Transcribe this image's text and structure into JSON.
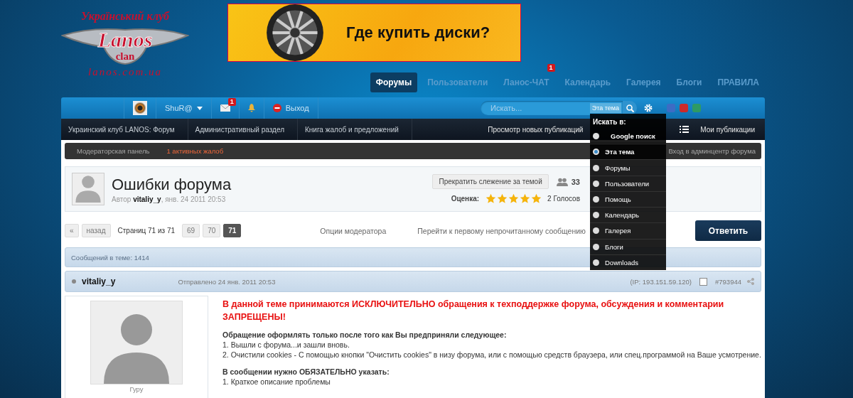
{
  "logo": {
    "tagline": "Український клуб",
    "name": "Lanos",
    "sub": "clan",
    "url": "lanos.com.ua"
  },
  "banner": {
    "text": "Где купить диски?"
  },
  "nav": [
    {
      "label": "Форумы",
      "selected": true
    },
    {
      "label": "Пользователи",
      "selected": false
    },
    {
      "label": "Ланос-ЧАТ",
      "selected": false,
      "badge": "1"
    },
    {
      "label": "Календарь",
      "selected": false
    },
    {
      "label": "Галерея",
      "selected": false
    },
    {
      "label": "Блоги",
      "selected": false
    },
    {
      "label": "ПРАВИЛА",
      "selected": false
    }
  ],
  "user_bar": {
    "username": "ShuR@",
    "messages_badge": "1",
    "logout": "Выход"
  },
  "search": {
    "placeholder": "Искать...",
    "scope": "Эта тема"
  },
  "search_menu": {
    "title": "Искать в:",
    "options": [
      {
        "label": "Google поиск",
        "selected": false
      },
      {
        "label": "Эта тема",
        "selected": true
      },
      {
        "label": "Форумы",
        "selected": false
      },
      {
        "label": "Пользователи",
        "selected": false
      },
      {
        "label": "Помощь",
        "selected": false
      },
      {
        "label": "Календарь",
        "selected": false
      },
      {
        "label": "Галерея",
        "selected": false
      },
      {
        "label": "Блоги",
        "selected": false
      },
      {
        "label": "Downloads",
        "selected": false
      }
    ]
  },
  "breadcrumbs": [
    "Украинский клуб LANOS: Форум",
    "Административный раздел",
    "Книга жалоб и предложений"
  ],
  "breadcrumb_links": [
    "Просмотр новых публикаций",
    "Мои публикации"
  ],
  "mod_bar": {
    "panel": "Модераторская панель",
    "reports": "1 активных жалоб",
    "admin": "Вход в админцентр форума"
  },
  "topic": {
    "title": "Ошибки форума",
    "author_prefix": "Автор",
    "author": "vitaliy_y",
    "date": ", янв. 24 2011 20:53",
    "follow": "Прекратить слежение за темой",
    "followers": "33",
    "rating_label": "Оценка:",
    "stars": 5,
    "votes": "2 Голосов"
  },
  "pagination": {
    "first": "«",
    "prev": "назад",
    "info": "Страниц 71 из 71",
    "pages": [
      {
        "label": "69",
        "selected": false
      },
      {
        "label": "70",
        "selected": false
      },
      {
        "label": "71",
        "selected": true
      }
    ]
  },
  "topic_actions": [
    "Опции модератора",
    "Перейти к первому непрочитанному сообщению"
  ],
  "reply_button": "Ответить",
  "post_count": "Сообщений в теме: 1414",
  "post": {
    "author": "vitaliy_y",
    "posted": "Отправлено 24 янв. 2011 20:53",
    "ip": "(IP: 193.151.59.120)",
    "selected": false,
    "number": "#793944",
    "rank": "Гуру",
    "warning": "В данной теме принимаются ИСКЛЮЧИТЕЛЬНО обращения к техподдержке форума, обсуждения и комментарии ЗАПРЕЩЕНЫ!",
    "heading1": "Обращение оформлять только после того как Вы предприняли следующее:",
    "steps": [
      "1. Вышли с форума...и зашли вновь.",
      "2. Очистили cookies - С помощью кнопки \"Очистить cookies\" в низу форума, или с помощью средств браузера, или спец.программой на Ваше усмотрение."
    ],
    "heading2": "В сообщении нужно ОБЯЗАТЕЛЬНО указать:",
    "items": [
      "1. Краткое описание проблемы"
    ]
  }
}
